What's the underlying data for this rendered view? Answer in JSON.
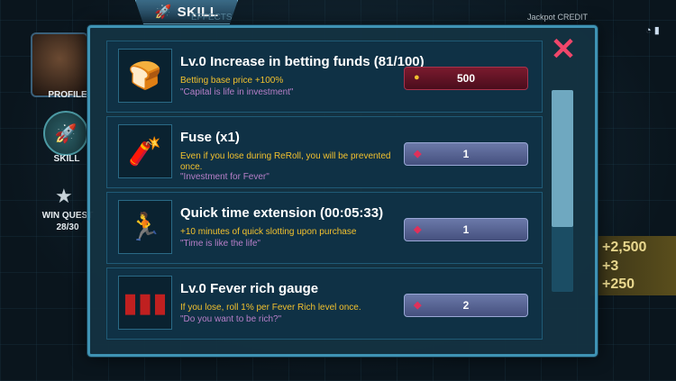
{
  "header": {
    "skill_tab": "SKILL",
    "effects_tab": "EFFECTS",
    "jackpot": "Jackpot CREDIT"
  },
  "left_panel": {
    "profile": "PROFILE",
    "skill": "SKILL",
    "win_quest": "WIN QUEST",
    "win_quest_count": "28/30"
  },
  "right_panel": {
    "reward1": "+2,500",
    "reward2": "+3",
    "reward3": "+250"
  },
  "close_label": "✕",
  "items": [
    {
      "title": "Lv.0 Increase in betting funds (81/100)",
      "desc": "Betting base price +100%",
      "quote": "\"Capital is life in investment\"",
      "price": "500",
      "currency": "coin",
      "icon": "bread-icon"
    },
    {
      "title": "Fuse (x1)",
      "desc": "Even if you lose during ReRoll, you will be prevented once.",
      "quote": "\"Investment for Fever\"",
      "price": "1",
      "currency": "gem",
      "icon": "fuse-icon"
    },
    {
      "title": "Quick time extension (00:05:33)",
      "desc": "+10 minutes of quick slotting upon purchase",
      "quote": "\"Time is like the life\"",
      "price": "1",
      "currency": "gem",
      "icon": "running-man-icon"
    },
    {
      "title": "Lv.0 Fever rich gauge",
      "desc": "If you lose, roll 1% per Fever Rich level once.",
      "quote": "\"Do you want to be rich?\"",
      "price": "2",
      "currency": "gem",
      "icon": "shotgun-shells-icon"
    }
  ],
  "colors": {
    "accent": "#3f93b4",
    "close": "#f0466a",
    "gold_text": "#f2c12e",
    "quote_text": "#b77fc8"
  }
}
